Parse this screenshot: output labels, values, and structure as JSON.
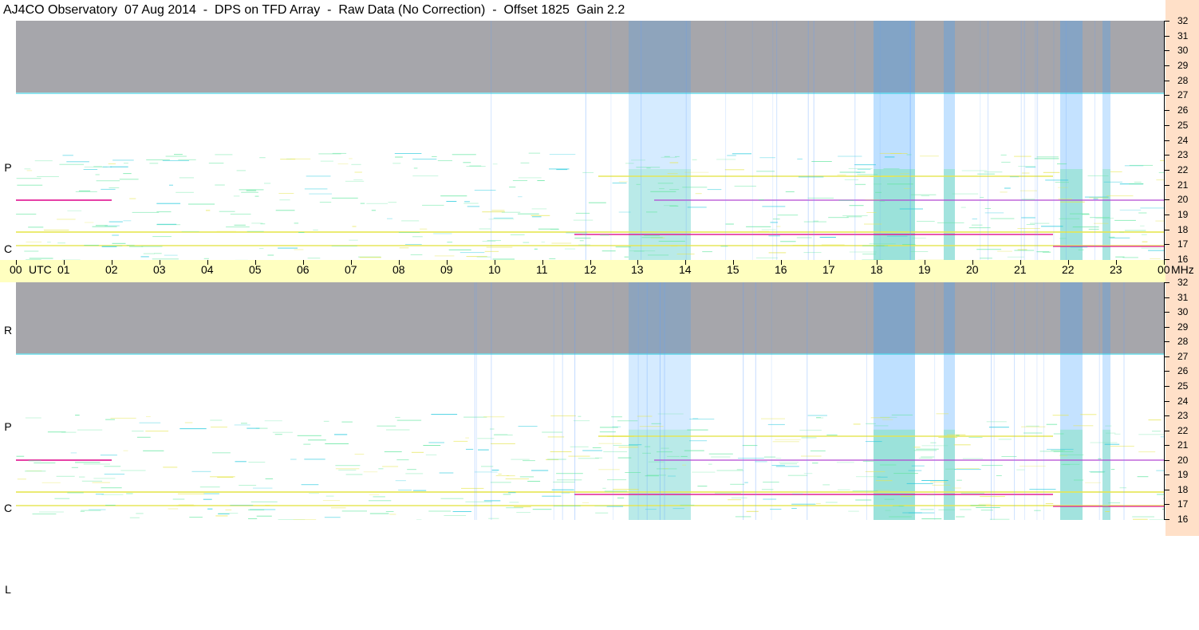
{
  "title": "AJ4CO Observatory  07 Aug 2014  -  DPS on TFD Array  -  Raw Data (No Correction)  -  Offset 1825  Gain 2.2",
  "panels": {
    "top": {
      "polarization_letters": [
        "P",
        "C",
        "R"
      ]
    },
    "bottom": {
      "polarization_letters": [
        "P",
        "C",
        "L"
      ]
    }
  },
  "time_axis": {
    "labels": [
      "00",
      "01",
      "02",
      "03",
      "04",
      "05",
      "06",
      "07",
      "08",
      "09",
      "10",
      "11",
      "12",
      "13",
      "14",
      "15",
      "16",
      "17",
      "18",
      "19",
      "20",
      "21",
      "22",
      "23",
      "00"
    ],
    "utc_label": "UTC",
    "unit_label": "MHz"
  },
  "freq_axis": {
    "labels": [
      "32",
      "31",
      "30",
      "29",
      "28",
      "27",
      "26",
      "25",
      "24",
      "23",
      "22",
      "21",
      "20",
      "19",
      "18",
      "17",
      "16"
    ]
  },
  "colors": {
    "background_dark": "#00001a",
    "mid_blue": "#0a3cd2",
    "cyan": "#1ec8dc",
    "green": "#64e6a0",
    "yellow": "#e6e650",
    "magenta": "#e01090",
    "time_bar": "#ffffc0",
    "right_strip": "#ffe0c8"
  }
}
